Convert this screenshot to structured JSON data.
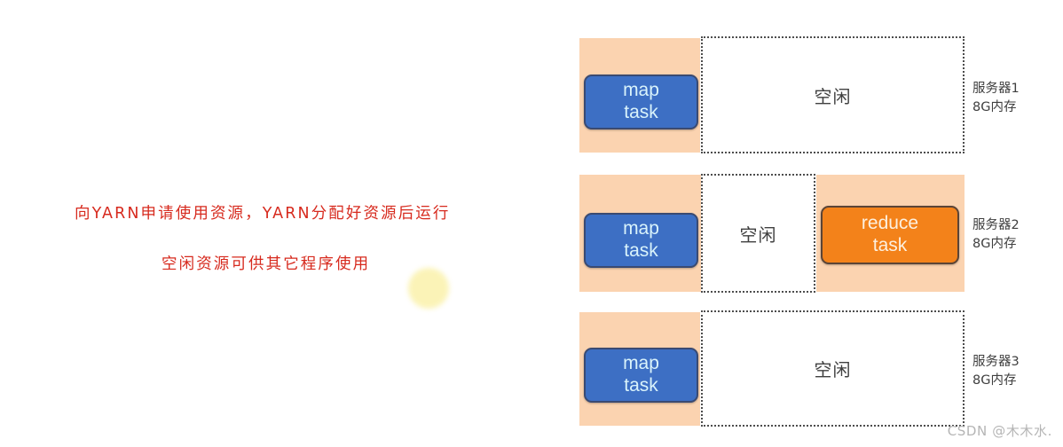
{
  "annotation": {
    "line1": "向YARN申请使用资源，YARN分配好资源后运行",
    "line2": "空闲资源可供其它程序使用",
    "color": "#d72a1e"
  },
  "highlight": {
    "name": "yellow-dot",
    "color": "#fbf3b4"
  },
  "palette": {
    "busy_block": "#fbd3b0",
    "map_task": "#3d6fc4",
    "reduce_task": "#f3821a",
    "idle_box": "#ffffff",
    "idle_border": "#4d4d4d"
  },
  "servers": [
    {
      "label_line1": "服务器1",
      "label_line2": "8G内存",
      "segments": [
        {
          "kind": "busy",
          "task": "map\ntask",
          "task_type": "map",
          "task_label_top": "map",
          "task_label_bottom": "task"
        },
        {
          "kind": "idle",
          "label": "空闲"
        }
      ]
    },
    {
      "label_line1": "服务器2",
      "label_line2": "8G内存",
      "segments": [
        {
          "kind": "busy",
          "task": "map\ntask",
          "task_type": "map",
          "task_label_top": "map",
          "task_label_bottom": "task"
        },
        {
          "kind": "idle",
          "label": "空闲"
        },
        {
          "kind": "busy",
          "task": "reduce\ntask",
          "task_type": "reduce",
          "task_label_top": "reduce",
          "task_label_bottom": "task"
        }
      ]
    },
    {
      "label_line1": "服务器3",
      "label_line2": "8G内存",
      "segments": [
        {
          "kind": "busy",
          "task": "map\ntask",
          "task_type": "map",
          "task_label_top": "map",
          "task_label_bottom": "task"
        },
        {
          "kind": "idle",
          "label": "空闲"
        }
      ]
    }
  ],
  "watermark": "CSDN @木木水."
}
